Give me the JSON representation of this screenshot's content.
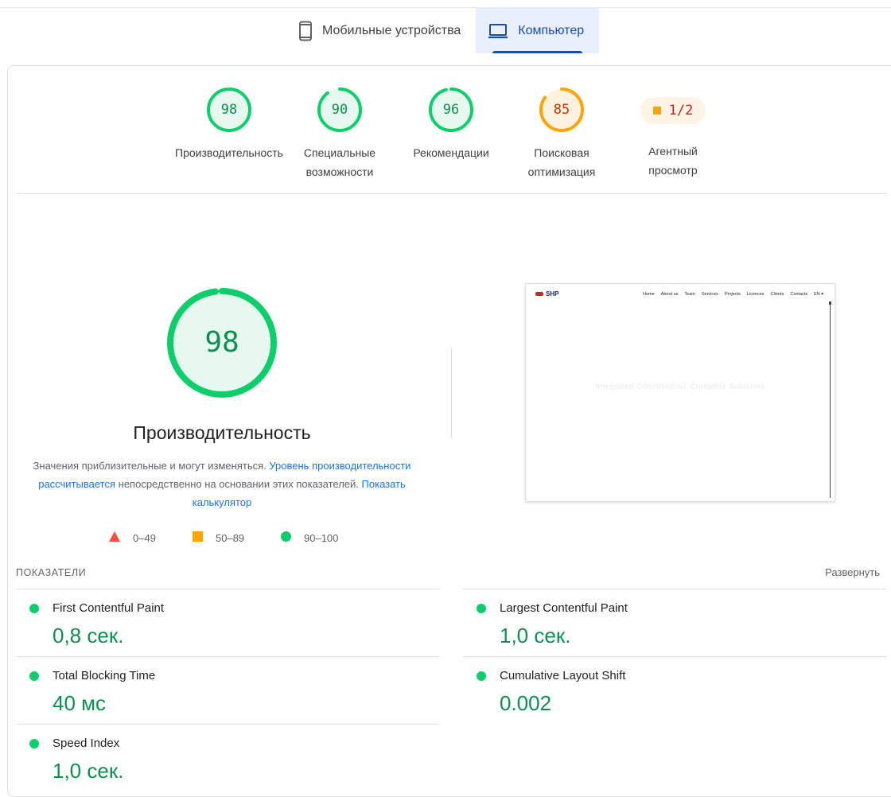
{
  "tabs": [
    {
      "label": "Мобильные устройства",
      "icon": "smartphone-icon",
      "active": false
    },
    {
      "label": "Компьютер",
      "icon": "laptop-icon",
      "active": true
    }
  ],
  "gauges": [
    {
      "score": "98",
      "label": "Производительность",
      "status": "pass",
      "color": "#0cce6b"
    },
    {
      "score": "90",
      "label": "Специальные возможности",
      "status": "pass",
      "color": "#0cce6b"
    },
    {
      "score": "96",
      "label": "Рекомендации",
      "status": "pass",
      "color": "#0cce6b"
    },
    {
      "score": "85",
      "label": "Поисковая оптимизация",
      "status": "average",
      "color": "#ffa400"
    },
    {
      "score": "1/2",
      "label": "Агентный просмотр",
      "status": "fraction",
      "color": "#ffa400"
    }
  ],
  "performance": {
    "score": "98",
    "title": "Производительность",
    "desc_part1": "Значения приблизительные и могут изменяться.",
    "desc_link1": "Уровень производительности рассчитывается",
    "desc_part2": "непосредственно на основании этих показателей.",
    "desc_link2": "Показать калькулятор"
  },
  "legend": [
    {
      "range": "0–49",
      "shape": "triangle-icon",
      "color": "#ff4e42"
    },
    {
      "range": "50–89",
      "shape": "square-icon",
      "color": "#ffa400"
    },
    {
      "range": "90–100",
      "shape": "circle-icon",
      "color": "#0cce6b"
    }
  ],
  "screenshot": {
    "logo": "SHP",
    "nav": [
      "Home",
      "About us",
      "Team",
      "Services",
      "Projects",
      "Licences",
      "Clients",
      "Contacts",
      "EN ▾"
    ],
    "hero": "Integrated Construction. Complete Solutions"
  },
  "metrics_header": {
    "title": "ПОКАЗАТЕЛИ",
    "expand": "Развернуть"
  },
  "metrics": [
    {
      "name": "First Contentful Paint",
      "value": "0,8 сек.",
      "status": "pass"
    },
    {
      "name": "Largest Contentful Paint",
      "value": "1,0 сек.",
      "status": "pass"
    },
    {
      "name": "Total Blocking Time",
      "value": "40 мс",
      "status": "pass"
    },
    {
      "name": "Cumulative Layout Shift",
      "value": "0.002",
      "status": "pass"
    },
    {
      "name": "Speed Index",
      "value": "1,0 сек.",
      "status": "pass"
    }
  ]
}
